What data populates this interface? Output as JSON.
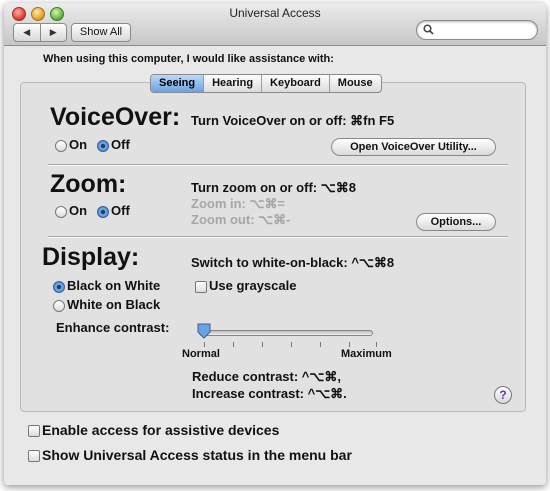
{
  "window": {
    "title": "Universal Access"
  },
  "toolbar": {
    "back": "◀",
    "forward": "▶",
    "show_all": "Show All",
    "search_placeholder": ""
  },
  "intro": "When using this computer, I would like assistance with:",
  "tabs": [
    {
      "label": "Seeing",
      "selected": true
    },
    {
      "label": "Hearing",
      "selected": false
    },
    {
      "label": "Keyboard",
      "selected": false
    },
    {
      "label": "Mouse",
      "selected": false
    }
  ],
  "voiceover": {
    "heading": "VoiceOver:",
    "shortcut": "Turn VoiceOver on or off: ⌘fn F5",
    "on_label": "On",
    "off_label": "Off",
    "selected": "Off",
    "utility_button": "Open VoiceOver Utility..."
  },
  "zoom": {
    "heading": "Zoom:",
    "shortcut": "Turn zoom on or off: ⌥⌘8",
    "zoom_in": "Zoom in: ⌥⌘=",
    "zoom_out": "Zoom out: ⌥⌘-",
    "on_label": "On",
    "off_label": "Off",
    "selected": "Off",
    "options_button": "Options..."
  },
  "display": {
    "heading": "Display:",
    "shortcut": "Switch to white-on-black: ^⌥⌘8",
    "black_on_white": "Black on White",
    "white_on_black": "White on Black",
    "selected": "Black on White",
    "grayscale_label": "Use grayscale",
    "grayscale_checked": false,
    "contrast_label": "Enhance contrast:",
    "contrast_min": "Normal",
    "contrast_max": "Maximum",
    "contrast_value": 0,
    "reduce_contrast": "Reduce contrast: ^⌥⌘,",
    "increase_contrast": "Increase contrast: ^⌥⌘."
  },
  "help": "?",
  "bottom": {
    "assistive_label": "Enable access for assistive devices",
    "assistive_checked": false,
    "status_label": "Show Universal Access status in the menu bar",
    "status_checked": false
  },
  "colors": {
    "selected_tab": "#6aa3e3",
    "help_glyph": "#6a3aa8"
  }
}
